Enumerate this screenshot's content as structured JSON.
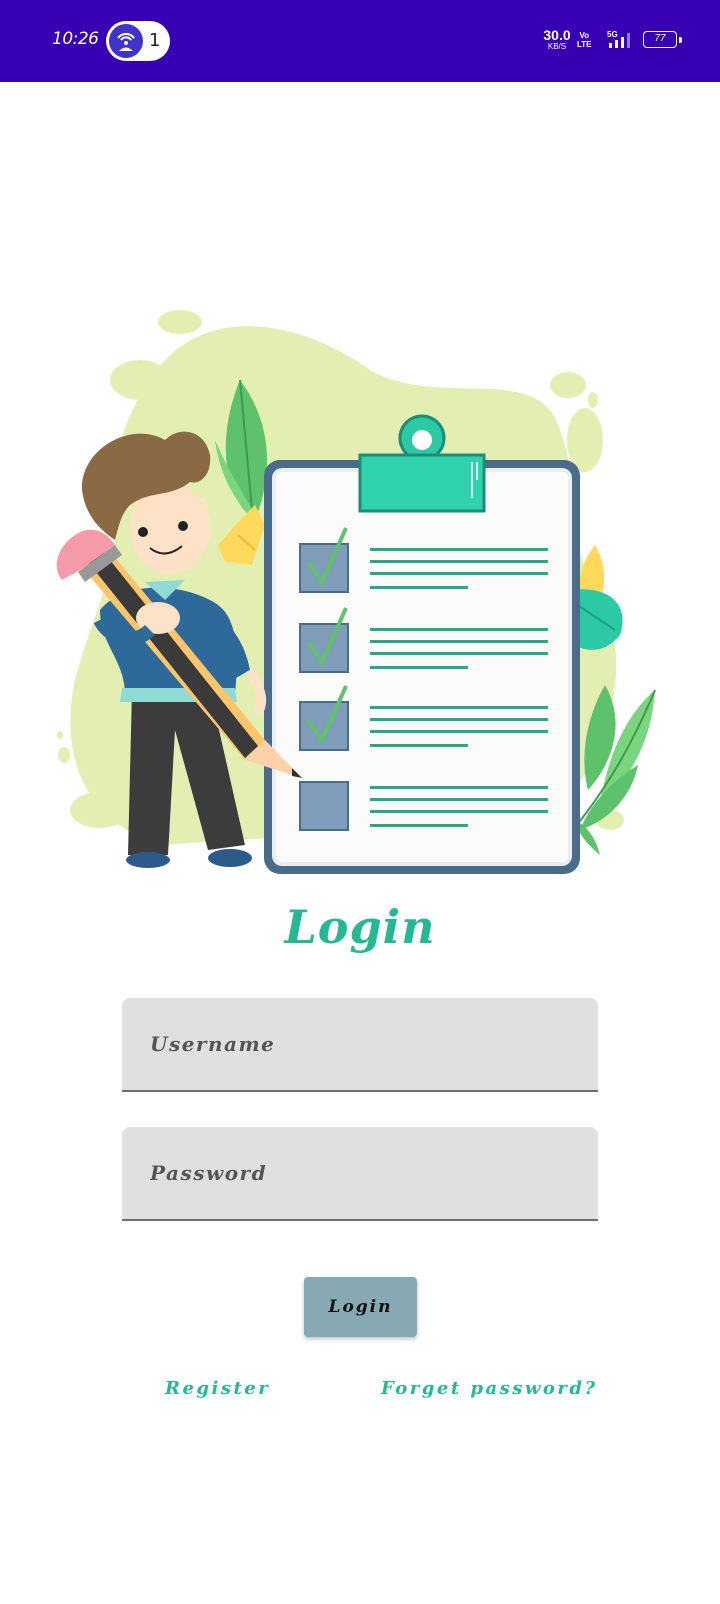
{
  "status_bar": {
    "time": "10:26",
    "hotspot_count": "1",
    "network_speed": "30.0",
    "network_speed_unit": "KB/S",
    "volte_top": "Vo",
    "volte_bottom": "LTE",
    "network_type": "5G",
    "battery_level": "77",
    "background_color": "#3700b3"
  },
  "illustration": {
    "icons": [
      "person-with-pencil",
      "clipboard-checklist",
      "leaf-decoration"
    ]
  },
  "login": {
    "title": "Login",
    "username_placeholder": "Username",
    "password_placeholder": "Password",
    "button_label": "Login",
    "register_link": "Register",
    "forgot_link": "Forget password?",
    "accent_color": "#26b796",
    "button_color": "#86a9b4"
  }
}
